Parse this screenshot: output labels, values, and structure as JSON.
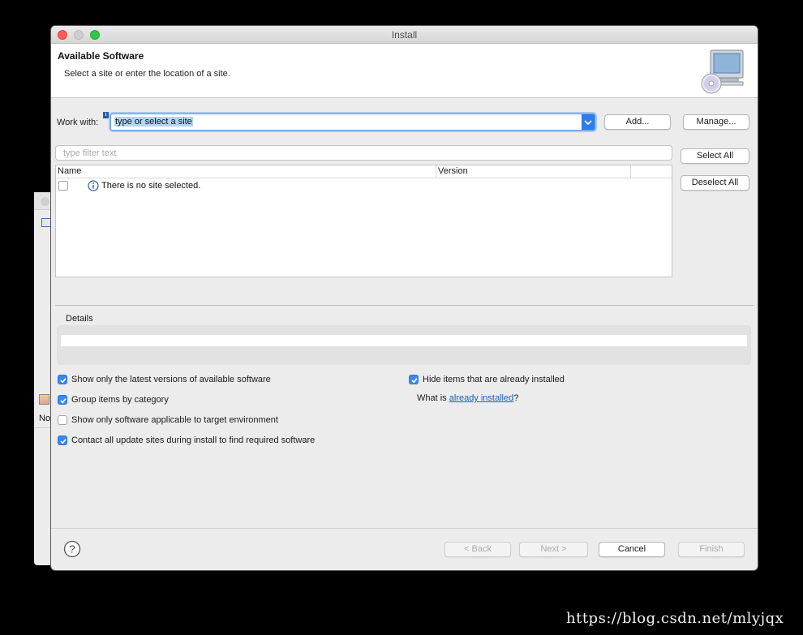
{
  "window": {
    "title": "Install"
  },
  "background_window": {
    "partial_label": "No"
  },
  "banner": {
    "title": "Available Software",
    "description": "Select a site or enter the location of a site."
  },
  "work_with": {
    "label": "Work with:",
    "value": "type or select a site",
    "add_button": "Add...",
    "manage_button": "Manage..."
  },
  "filter": {
    "placeholder": "type filter text"
  },
  "table": {
    "columns": [
      "Name",
      "Version"
    ],
    "message": "There is no site selected."
  },
  "side_buttons": {
    "select_all": "Select All",
    "deselect_all": "Deselect All"
  },
  "details": {
    "label": "Details"
  },
  "options": {
    "show_latest": {
      "label": "Show only the latest versions of available software",
      "checked": true
    },
    "group_by_category": {
      "label": "Group items by category",
      "checked": true
    },
    "show_applicable": {
      "label": "Show only software applicable to target environment",
      "checked": false
    },
    "contact_all": {
      "label": "Contact all update sites during install to find required software",
      "checked": true
    },
    "hide_installed": {
      "label": "Hide items that are already installed",
      "checked": true
    },
    "what_is_prefix": "What is ",
    "what_is_link": "already installed",
    "what_is_suffix": "?"
  },
  "footer": {
    "back": "< Back",
    "next": "Next >",
    "cancel": "Cancel",
    "finish": "Finish"
  },
  "watermark": "https://blog.csdn.net/mlyjqx",
  "colors": {
    "accent": "#3b88f0",
    "link": "#1c5fb8",
    "close": "#fc5f57",
    "maximize": "#33c748"
  }
}
